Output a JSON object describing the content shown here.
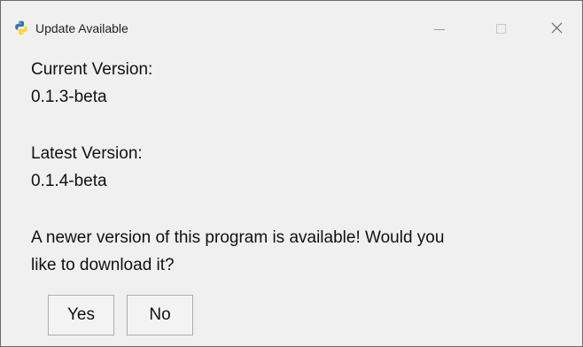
{
  "window": {
    "title": "Update Available",
    "controls": {
      "minimize_icon": "minimize-icon",
      "maximize_icon": "maximize-icon",
      "close_icon": "close-icon"
    },
    "app_icon": "python-logo-icon"
  },
  "body": {
    "current_version_label": "Current Version:",
    "current_version_value": "0.1.3-beta",
    "latest_version_label": "Latest Version:",
    "latest_version_value": "0.1.4-beta",
    "message_line1": "A newer version of this program is available!  Would you",
    "message_line2": "like to download it?"
  },
  "buttons": {
    "yes_label": "Yes",
    "no_label": "No"
  },
  "colors": {
    "window_bg": "#f0f0f0",
    "python_blue": "#3776ab",
    "python_yellow": "#ffd43b"
  }
}
